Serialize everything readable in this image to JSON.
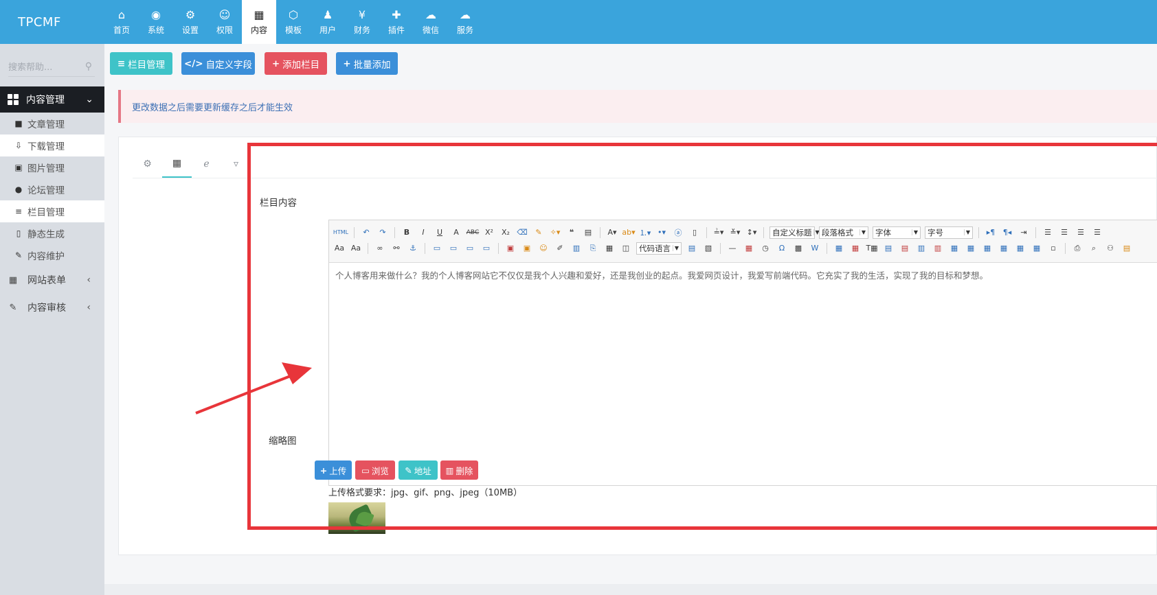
{
  "app": {
    "logo": "TPCMF"
  },
  "topnav": [
    {
      "icon": "home-icon",
      "glyph": "⌂",
      "label": "首页"
    },
    {
      "icon": "globe-icon",
      "glyph": "◉",
      "label": "系统"
    },
    {
      "icon": "cogs-icon",
      "glyph": "⚙",
      "label": "设置"
    },
    {
      "icon": "user-circle-icon",
      "glyph": "☺",
      "label": "权限"
    },
    {
      "icon": "grid-icon",
      "glyph": "▦",
      "label": "内容",
      "active": true
    },
    {
      "icon": "html5-icon",
      "glyph": "⬡",
      "label": "模板"
    },
    {
      "icon": "user-icon",
      "glyph": "♟",
      "label": "用户"
    },
    {
      "icon": "yen-icon",
      "glyph": "¥",
      "label": "财务"
    },
    {
      "icon": "puzzle-icon",
      "glyph": "✚",
      "label": "插件"
    },
    {
      "icon": "wechat-icon",
      "glyph": "☁",
      "label": "微信"
    },
    {
      "icon": "cloud-icon",
      "glyph": "☁",
      "label": "服务"
    }
  ],
  "sidebar": {
    "search_placeholder": "搜索帮助...",
    "section_title": "内容管理",
    "items": [
      {
        "label": "文章管理",
        "glyph": "■",
        "icon": "sticky-note-icon"
      },
      {
        "label": "下载管理",
        "glyph": "⇩",
        "icon": "download-icon",
        "highlight": true
      },
      {
        "label": "图片管理",
        "glyph": "▣",
        "icon": "image-icon"
      },
      {
        "label": "论坛管理",
        "glyph": "●",
        "icon": "comments-icon"
      },
      {
        "label": "栏目管理",
        "glyph": "≡",
        "icon": "list-icon",
        "highlight": true
      },
      {
        "label": "静态生成",
        "glyph": "▯",
        "icon": "file-icon"
      },
      {
        "label": "内容维护",
        "glyph": "✎",
        "icon": "wrench-icon"
      }
    ],
    "groups": [
      {
        "label": "网站表单",
        "glyph": "▦",
        "icon": "table-icon"
      },
      {
        "label": "内容审核",
        "glyph": "✎",
        "icon": "edit-icon"
      }
    ]
  },
  "actions": {
    "column_manage": "栏目管理",
    "custom_field": "自定义字段",
    "add_column": "添加栏目",
    "batch_add": "批量添加"
  },
  "alert": {
    "text": "更改数据之后需要更新缓存之后才能生效"
  },
  "tabs": [
    {
      "icon": "gear-icon",
      "glyph": "⚙"
    },
    {
      "icon": "table-icon",
      "glyph": "▦",
      "active": true
    },
    {
      "icon": "ie-icon",
      "glyph": "ℯ"
    },
    {
      "icon": "html5-icon",
      "glyph": "▿"
    }
  ],
  "form": {
    "content_label": "栏目内容",
    "thumb_label": "缩略图",
    "editor_text": "个人博客用来做什么？我的个人博客网站它不仅仅是我个人兴趣和爱好，还是我创业的起点。我爱网页设计，我爱写前端代码。它充实了我的生活，实现了我的目标和梦想。",
    "toolbar_combos": {
      "custom_title": "自定义标题",
      "paragraph": "段落格式",
      "font": "字体",
      "font_size": "字号",
      "code_lang": "代码语言"
    },
    "upload_buttons": {
      "upload": "上传",
      "browse": "浏览",
      "address": "地址",
      "delete": "删除"
    },
    "upload_hint": "上传格式要求：jpg、gif、png、jpeg（10MB）"
  },
  "colors": {
    "topbar": "#3aa4dc",
    "teal": "#3ec3c8",
    "blue": "#3b8fd9",
    "red": "#e5535f",
    "annotation": "#e8353a"
  }
}
